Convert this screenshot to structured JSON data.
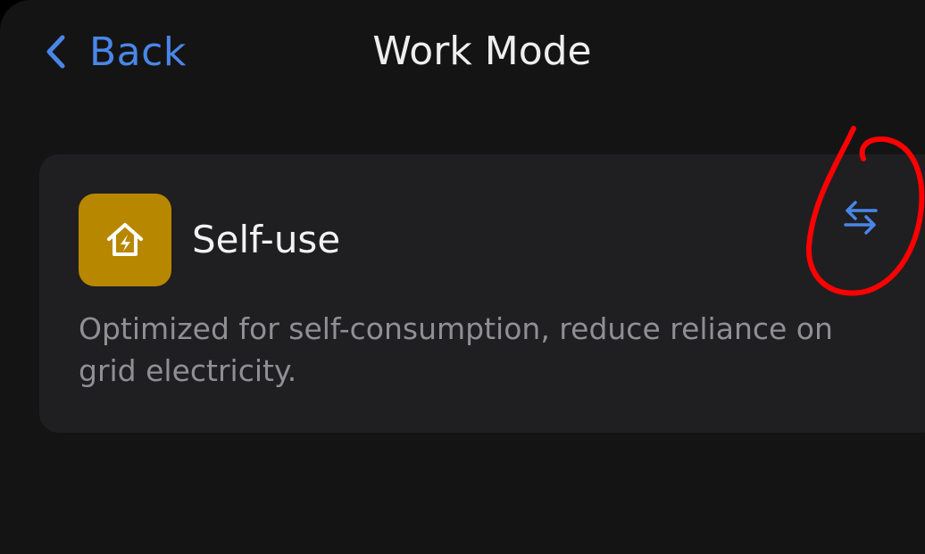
{
  "nav": {
    "back_label": "Back",
    "back_icon": "chevron-left-icon",
    "title": "Work Mode"
  },
  "mode_card": {
    "icon": "house-lightning-icon",
    "name": "Self-use",
    "switch_icon": "swap-arrows-icon",
    "description": "Optimized for self-consumption, reduce reliance on grid electricity."
  },
  "colors": {
    "background": "#141415",
    "card": "#1f1f21",
    "accent": "#4a86e8",
    "mode_icon_bg": "#b88700",
    "annotation": "#ff0000"
  }
}
